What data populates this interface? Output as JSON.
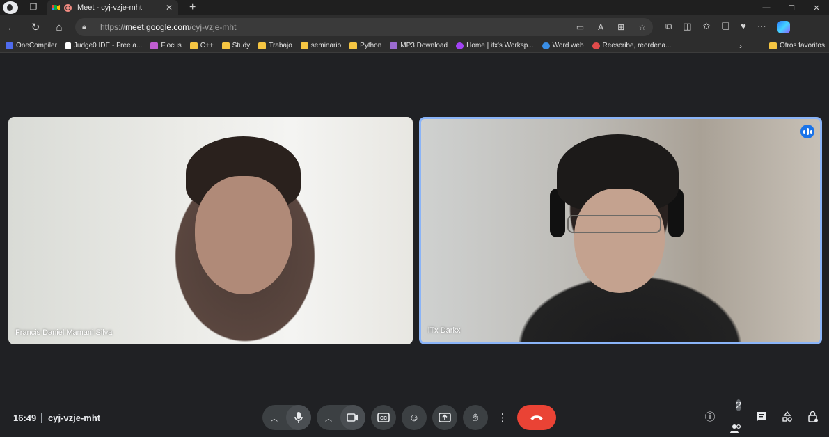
{
  "browser": {
    "tab": {
      "title": "Meet - cyj-vzje-mht"
    },
    "address": {
      "scheme": "https://",
      "host": "meet.google.com",
      "path": "/cyj-vzje-mht"
    },
    "bookmarks": [
      {
        "label": "OneCompiler",
        "icon": "onecompiler-icon",
        "color": "#4f6bed"
      },
      {
        "label": "Judge0 IDE - Free a...",
        "icon": "judge0-icon",
        "color": "#ffffff"
      },
      {
        "label": "Flocus",
        "icon": "flocus-icon",
        "color": "#c05dd1"
      },
      {
        "label": "C++",
        "icon": "folder-icon",
        "color": "#f5c542"
      },
      {
        "label": "Study",
        "icon": "folder-icon",
        "color": "#f5c542"
      },
      {
        "label": "Trabajo",
        "icon": "folder-icon",
        "color": "#f5c542"
      },
      {
        "label": "seminario",
        "icon": "folder-icon",
        "color": "#f5c542"
      },
      {
        "label": "Python",
        "icon": "folder-icon",
        "color": "#f5c542"
      },
      {
        "label": "MP3 Download",
        "icon": "mp3-icon",
        "color": "#9b6bd1"
      },
      {
        "label": "Home | itx's Worksp...",
        "icon": "workspace-icon",
        "color": "#a142f4"
      },
      {
        "label": "Word web",
        "icon": "onedrive-icon",
        "color": "#3a8ee6"
      },
      {
        "label": "Reescribe, reordena...",
        "icon": "rewrite-icon",
        "color": "#e04b4b"
      }
    ],
    "other_favorites": "Otros favoritos"
  },
  "meet": {
    "participants": [
      {
        "name": "Francis Daniel Mamani Silva"
      },
      {
        "name": "iTx Darkx"
      }
    ],
    "clock": "16:49",
    "meeting_code": "cyj-vzje-mht",
    "participant_count": "2",
    "accent": "#8ab4f8",
    "hangup_color": "#ea4335"
  }
}
